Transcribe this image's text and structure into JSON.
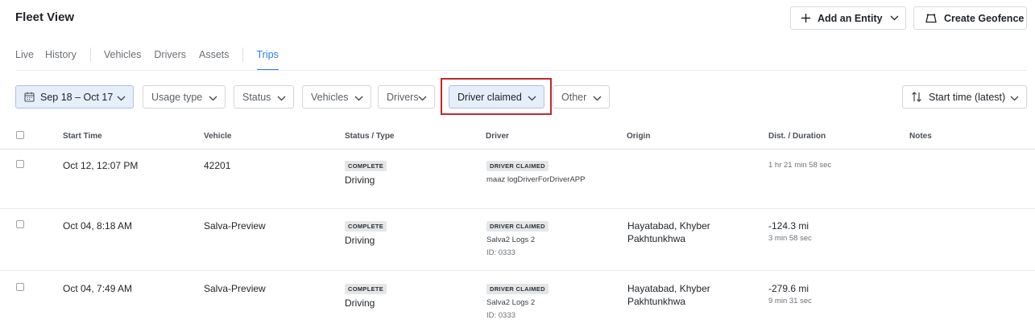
{
  "header": {
    "title": "Fleet View",
    "add_entity_label": "Add an Entity",
    "create_geofence_label": "Create Geofence"
  },
  "tabs": [
    {
      "label": "Live",
      "active": false
    },
    {
      "label": "History",
      "active": false
    },
    {
      "label": "Vehicles",
      "active": false
    },
    {
      "label": "Drivers",
      "active": false
    },
    {
      "label": "Assets",
      "active": false
    },
    {
      "label": "Trips",
      "active": true
    }
  ],
  "filters": {
    "date_range": "Sep 18 – Oct 17",
    "usage_type": "Usage type",
    "status": "Status",
    "vehicles": "Vehicles",
    "drivers": "Drivers",
    "driver_claimed": "Driver claimed",
    "other": "Other"
  },
  "sort": {
    "label": "Start time (latest)"
  },
  "table": {
    "columns": [
      "Start Time",
      "Vehicle",
      "Status / Type",
      "Driver",
      "Origin",
      "Dist. / Duration",
      "Notes"
    ],
    "rows": [
      {
        "start_time": "Oct 12, 12:07 PM",
        "vehicle": "42201",
        "status": "COMPLETE",
        "type": "Driving",
        "driver_badge": "DRIVER CLAIMED",
        "driver_name": "maaz logDriverForDriverAPP",
        "driver_id": "",
        "origin_line1": "",
        "origin_line2": "",
        "distance": "",
        "duration": "1 hr 21 min 58 sec",
        "notes": ""
      },
      {
        "start_time": "Oct 04, 8:18 AM",
        "vehicle": "Salva-Preview",
        "status": "COMPLETE",
        "type": "Driving",
        "driver_badge": "DRIVER CLAIMED",
        "driver_name": "Salva2 Logs 2",
        "driver_id": "ID: 0333",
        "origin_line1": "Hayatabad, Khyber",
        "origin_line2": "Pakhtunkhwa",
        "distance": "-124.3 mi",
        "duration": "3 min 58 sec",
        "notes": ""
      },
      {
        "start_time": "Oct 04, 7:49 AM",
        "vehicle": "Salva-Preview",
        "status": "COMPLETE",
        "type": "Driving",
        "driver_badge": "DRIVER CLAIMED",
        "driver_name": "Salva2 Logs 2",
        "driver_id": "ID: 0333",
        "origin_line1": "Hayatabad, Khyber",
        "origin_line2": "Pakhtunkhwa",
        "distance": "-279.6 mi",
        "duration": "9 min 31 sec",
        "notes": ""
      }
    ]
  },
  "icons": {
    "add": "plus-icon",
    "geofence": "geofence-icon",
    "calendar": "calendar-icon",
    "chevron": "chevron-down-icon",
    "sort": "sort-icon"
  },
  "colors": {
    "accent": "#2a7de1",
    "highlight_box": "#c3262b",
    "selected_filter_bg": "#e6eef9",
    "badge_bg": "#e4e6e8"
  }
}
